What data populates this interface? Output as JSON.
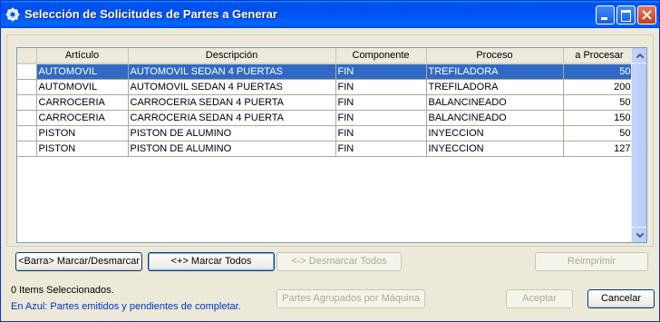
{
  "window": {
    "title": "Selección de Solicitudes de Partes a Generar",
    "icon": "gear-icon"
  },
  "grid": {
    "columns": [
      "Artículo",
      "Descripción",
      "Componente",
      "Proceso",
      "a Procesar"
    ],
    "rows": [
      {
        "articulo": "AUTOMOVIL",
        "descripcion": "AUTOMOVIL SEDAN 4 PUERTAS",
        "componente": "FIN",
        "proceso": "TREFILADORA",
        "cantidad": "50",
        "selected": true
      },
      {
        "articulo": "AUTOMOVIL",
        "descripcion": "AUTOMOVIL SEDAN 4 PUERTAS",
        "componente": "FIN",
        "proceso": "TREFILADORA",
        "cantidad": "200",
        "selected": false
      },
      {
        "articulo": "CARROCERIA",
        "descripcion": "CARROCERIA SEDAN 4 PUERTA",
        "componente": "FIN",
        "proceso": "BALANCINEADO",
        "cantidad": "50",
        "selected": false
      },
      {
        "articulo": "CARROCERIA",
        "descripcion": "CARROCERIA SEDAN 4 PUERTA",
        "componente": "FIN",
        "proceso": "BALANCINEADO",
        "cantidad": "150",
        "selected": false
      },
      {
        "articulo": "PISTON",
        "descripcion": "PISTON DE ALUMINO",
        "componente": "FIN",
        "proceso": "INYECCION",
        "cantidad": "50",
        "selected": false
      },
      {
        "articulo": "PISTON",
        "descripcion": "PISTON DE ALUMINO",
        "componente": "FIN",
        "proceso": "INYECCION",
        "cantidad": "127",
        "selected": false
      }
    ]
  },
  "buttons": {
    "marcar_desmarcar": "<Barra> Marcar/Desmarcar",
    "marcar_todos": "<+> Marcar Todos",
    "desmarcar_todos": "<-> Desmarcar Todos",
    "reimprimir": "Reimprimir",
    "partes_agrupados": "Partes Agrupados por Máquina",
    "aceptar": "Aceptar",
    "cancelar": "Cancelar"
  },
  "status": {
    "selected_count": "0 Items Seleccionados.",
    "legend": "En Azul: Partes emitidos y pendientes de completar."
  },
  "colors": {
    "selection": "#316ac5",
    "legend_text": "#0033cc",
    "title_bar": "#0054e3"
  }
}
